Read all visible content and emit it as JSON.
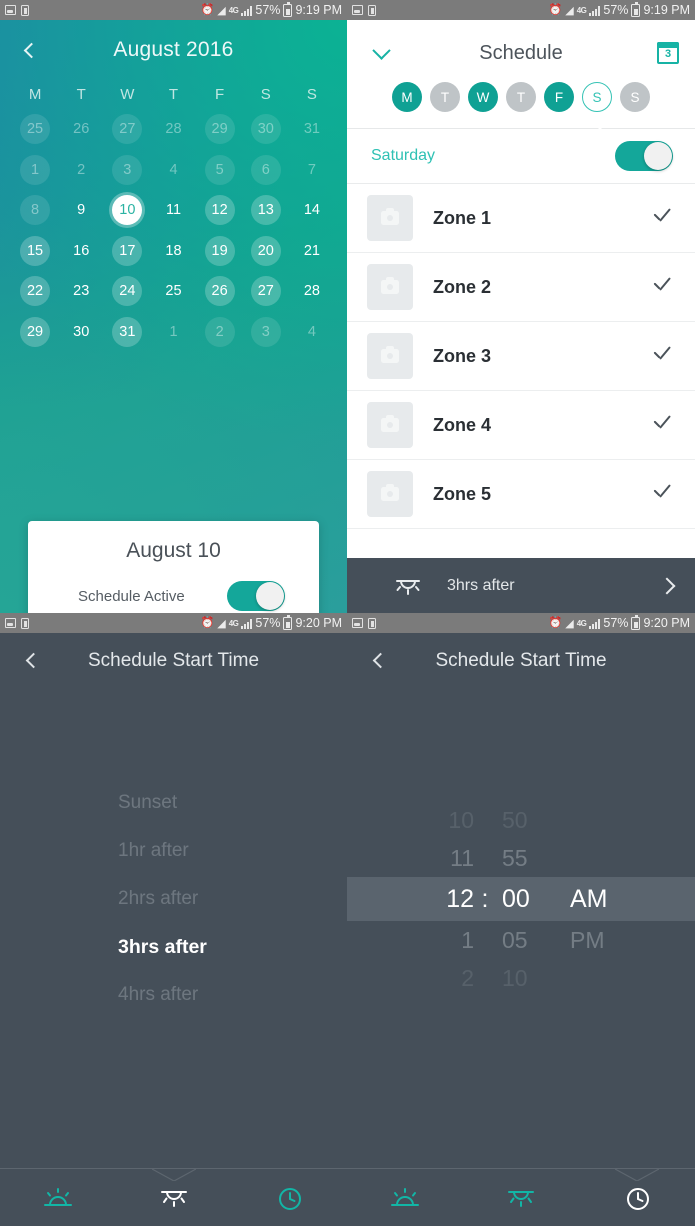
{
  "theme": {
    "teal": "#0fa194",
    "teal_light": "#2fc1b4",
    "dark": "#454f59",
    "status_bar": "#7b7b7b"
  },
  "status_bars": [
    {
      "battery": "57%",
      "time": "9:19 PM",
      "network": "4G",
      "icons": [
        "image-icon",
        "sim-icon",
        "alarm-icon",
        "wifi-icon",
        "lte-icon",
        "signal-icon",
        "battery-icon"
      ]
    },
    {
      "battery": "57%",
      "time": "9:19 PM",
      "network": "4G",
      "icons": [
        "image-icon",
        "sim-icon",
        "alarm-icon",
        "wifi-icon",
        "lte-icon",
        "signal-icon",
        "battery-icon"
      ]
    },
    {
      "battery": "57%",
      "time": "9:20 PM",
      "network": "4G",
      "icons": [
        "image-icon",
        "sim-icon",
        "alarm-icon",
        "wifi-icon",
        "lte-icon",
        "signal-icon",
        "battery-icon"
      ]
    },
    {
      "battery": "57%",
      "time": "9:20 PM",
      "network": "4G",
      "icons": [
        "image-icon",
        "sim-icon",
        "alarm-icon",
        "wifi-icon",
        "lte-icon",
        "signal-icon",
        "battery-icon"
      ]
    }
  ],
  "calendar_screen": {
    "back_icon": "chevron-left-icon",
    "title": "August 2016",
    "dow": [
      "M",
      "T",
      "W",
      "T",
      "F",
      "S",
      "S"
    ],
    "weeks": [
      [
        {
          "n": "25",
          "dim": true,
          "mark": true
        },
        {
          "n": "26",
          "dim": true,
          "mark": false
        },
        {
          "n": "27",
          "dim": true,
          "mark": true
        },
        {
          "n": "28",
          "dim": true,
          "mark": false
        },
        {
          "n": "29",
          "dim": true,
          "mark": true
        },
        {
          "n": "30",
          "dim": true,
          "mark": true
        },
        {
          "n": "31",
          "dim": true,
          "mark": false
        }
      ],
      [
        {
          "n": "1",
          "dim": true,
          "mark": true
        },
        {
          "n": "2",
          "dim": true,
          "mark": false
        },
        {
          "n": "3",
          "dim": true,
          "mark": true
        },
        {
          "n": "4",
          "dim": true,
          "mark": false
        },
        {
          "n": "5",
          "dim": true,
          "mark": true
        },
        {
          "n": "6",
          "dim": true,
          "mark": true
        },
        {
          "n": "7",
          "dim": true,
          "mark": false
        }
      ],
      [
        {
          "n": "8",
          "dim": true,
          "mark": true
        },
        {
          "n": "9",
          "dim": false,
          "mark": false
        },
        {
          "n": "10",
          "dim": false,
          "mark": false,
          "today": true
        },
        {
          "n": "11",
          "dim": false,
          "mark": false
        },
        {
          "n": "12",
          "dim": false,
          "mark": true
        },
        {
          "n": "13",
          "dim": false,
          "mark": true
        },
        {
          "n": "14",
          "dim": false,
          "mark": false
        }
      ],
      [
        {
          "n": "15",
          "dim": false,
          "mark": true
        },
        {
          "n": "16",
          "dim": false,
          "mark": false
        },
        {
          "n": "17",
          "dim": false,
          "mark": true
        },
        {
          "n": "18",
          "dim": false,
          "mark": false
        },
        {
          "n": "19",
          "dim": false,
          "mark": true
        },
        {
          "n": "20",
          "dim": false,
          "mark": true
        },
        {
          "n": "21",
          "dim": false,
          "mark": false
        }
      ],
      [
        {
          "n": "22",
          "dim": false,
          "mark": true
        },
        {
          "n": "23",
          "dim": false,
          "mark": false
        },
        {
          "n": "24",
          "dim": false,
          "mark": true
        },
        {
          "n": "25",
          "dim": false,
          "mark": false
        },
        {
          "n": "26",
          "dim": false,
          "mark": true
        },
        {
          "n": "27",
          "dim": false,
          "mark": true
        },
        {
          "n": "28",
          "dim": false,
          "mark": false
        }
      ],
      [
        {
          "n": "29",
          "dim": false,
          "mark": true
        },
        {
          "n": "30",
          "dim": false,
          "mark": false
        },
        {
          "n": "31",
          "dim": false,
          "mark": true
        },
        {
          "n": "1",
          "dim": true,
          "mark": false
        },
        {
          "n": "2",
          "dim": true,
          "mark": true
        },
        {
          "n": "3",
          "dim": true,
          "mark": true
        },
        {
          "n": "4",
          "dim": true,
          "mark": false
        }
      ]
    ],
    "card": {
      "title": "August 10",
      "toggle_label": "Schedule Active",
      "toggle_on": true
    }
  },
  "schedule_screen": {
    "collapse_icon": "chevron-down-icon",
    "title": "Schedule",
    "calendar_icon": "calendar-icon",
    "calendar_icon_number": "3",
    "days": [
      {
        "letter": "M",
        "state": "on"
      },
      {
        "letter": "T",
        "state": "off"
      },
      {
        "letter": "W",
        "state": "on"
      },
      {
        "letter": "T",
        "state": "off"
      },
      {
        "letter": "F",
        "state": "on"
      },
      {
        "letter": "S",
        "state": "selected"
      },
      {
        "letter": "S",
        "state": "off"
      }
    ],
    "day_label": "Saturday",
    "day_toggle_on": true,
    "zones": [
      {
        "name": "Zone 1",
        "thumb_icon": "camera-icon",
        "checked": true
      },
      {
        "name": "Zone 2",
        "thumb_icon": "camera-icon",
        "checked": true
      },
      {
        "name": "Zone 3",
        "thumb_icon": "camera-icon",
        "checked": true
      },
      {
        "name": "Zone 4",
        "thumb_icon": "camera-icon",
        "checked": true
      },
      {
        "name": "Zone 5",
        "thumb_icon": "camera-icon",
        "checked": true
      }
    ],
    "footer": {
      "icon": "sunset-icon",
      "label": "3hrs after",
      "chevron": "chevron-right-icon"
    }
  },
  "start_time_offset_screen": {
    "back_icon": "chevron-left-icon",
    "title": "Schedule Start Time",
    "options": [
      "Sunset",
      "1hr after",
      "2hrs after",
      "3hrs after",
      "4hrs after"
    ],
    "selected": "3hrs after",
    "tabs": [
      {
        "icon": "sunrise-icon",
        "active": false
      },
      {
        "icon": "sunset-icon",
        "active": true
      },
      {
        "icon": "clock-icon",
        "active": false
      }
    ]
  },
  "start_time_clock_screen": {
    "back_icon": "chevron-left-icon",
    "title": "Schedule Start Time",
    "rows": [
      {
        "hour": "10",
        "minute": "50",
        "meridiem": "",
        "state": "faint"
      },
      {
        "hour": "11",
        "minute": "55",
        "meridiem": "",
        "state": "near"
      },
      {
        "hour": "12",
        "minute": "00",
        "meridiem": "AM",
        "state": "sel"
      },
      {
        "hour": "1",
        "minute": "05",
        "meridiem": "PM",
        "state": "near"
      },
      {
        "hour": "2",
        "minute": "10",
        "meridiem": "",
        "state": "faint"
      }
    ],
    "separator": ":",
    "selected_time": "12:00 AM",
    "tabs": [
      {
        "icon": "sunrise-icon",
        "active": false
      },
      {
        "icon": "sunset-icon",
        "active": false
      },
      {
        "icon": "clock-icon",
        "active": true
      }
    ]
  }
}
